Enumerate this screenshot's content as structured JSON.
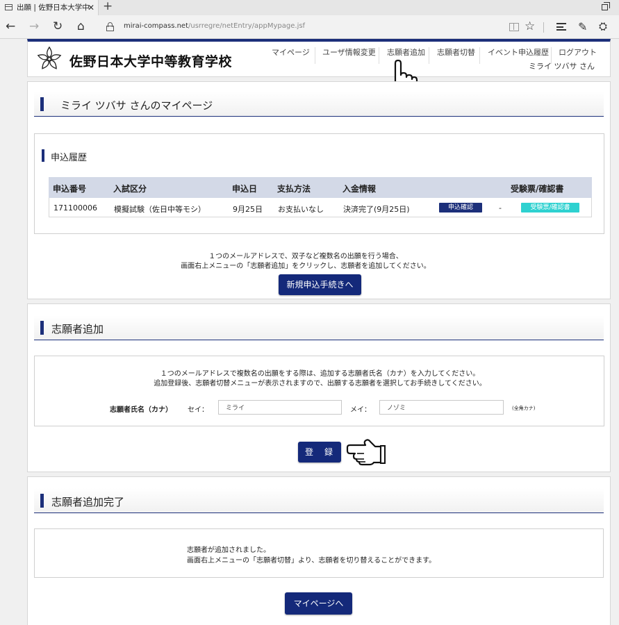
{
  "browser": {
    "tab_title": "出願 | 佐野日本大学中",
    "tab_close": "✕",
    "new_tab": "+",
    "url_host": "mirai-compass.net",
    "url_path": "/usrregre/netEntry/appMypage.jsf",
    "icons": [
      "back-icon",
      "forward-icon",
      "refresh-icon",
      "home-icon",
      "lock-icon",
      "reading-view-icon",
      "favorite-star-icon",
      "hub-icon",
      "web-note-icon",
      "share-icon"
    ]
  },
  "header": {
    "school_name": "佐野日本大学中等教育学校",
    "nav": [
      "マイページ",
      "ユーザ情報変更",
      "志願者追加",
      "志願者切替",
      "イベント申込履歴",
      "ログアウト"
    ],
    "user_name": "ミライ ツバサ さん"
  },
  "mypage": {
    "title": "ミライ ツバサ さんのマイページ",
    "history_title": "申込履歴",
    "table": {
      "headers": [
        "申込番号",
        "入試区分",
        "申込日",
        "支払方法",
        "入金情報",
        "受験票/確認書"
      ],
      "rows": [
        {
          "number": "171100006",
          "category": "模擬試験（佐日中等モシ）",
          "date": "9月25日",
          "payment": "お支払いなし",
          "deposit": "決済完了(9月25日)",
          "confirm_button": "申込確認",
          "dash": "-",
          "ticket_button": "受験票/確認書"
        }
      ]
    },
    "note_line1": "１つのメールアドレスで、双子など複数名の出願を行う場合、",
    "note_line2": "画面右上メニューの「志願者追加」をクリックし、志願者を追加してください。",
    "new_application_button": "新規申込手続きへ"
  },
  "add_applicant": {
    "title": "志願者追加",
    "note_line1": "１つのメールアドレスで複数名の出願をする際は、追加する志願者氏名（カナ）を入力してください。",
    "note_line2": "追加登録後、志願者切替メニューが表示されますので、出願する志願者を選択してお手続きしてください。",
    "name_label": "志願者氏名（カナ）",
    "sei_label": "セイ：",
    "sei_value": "ミライ",
    "mei_label": "メイ：",
    "mei_value": "ノゾミ",
    "kana_note": "(全角カナ)",
    "register_button": "登　録"
  },
  "complete": {
    "title": "志願者追加完了",
    "line1": "志願者が追加されました。",
    "line2": "画面右上メニューの「志願者切替」より、志願者を切り替えることができます。",
    "mypage_button": "マイページへ"
  },
  "colors": {
    "navy": "#1c2f7a",
    "table_header": "#d3d9e7",
    "teal": "#2ed1d0"
  }
}
